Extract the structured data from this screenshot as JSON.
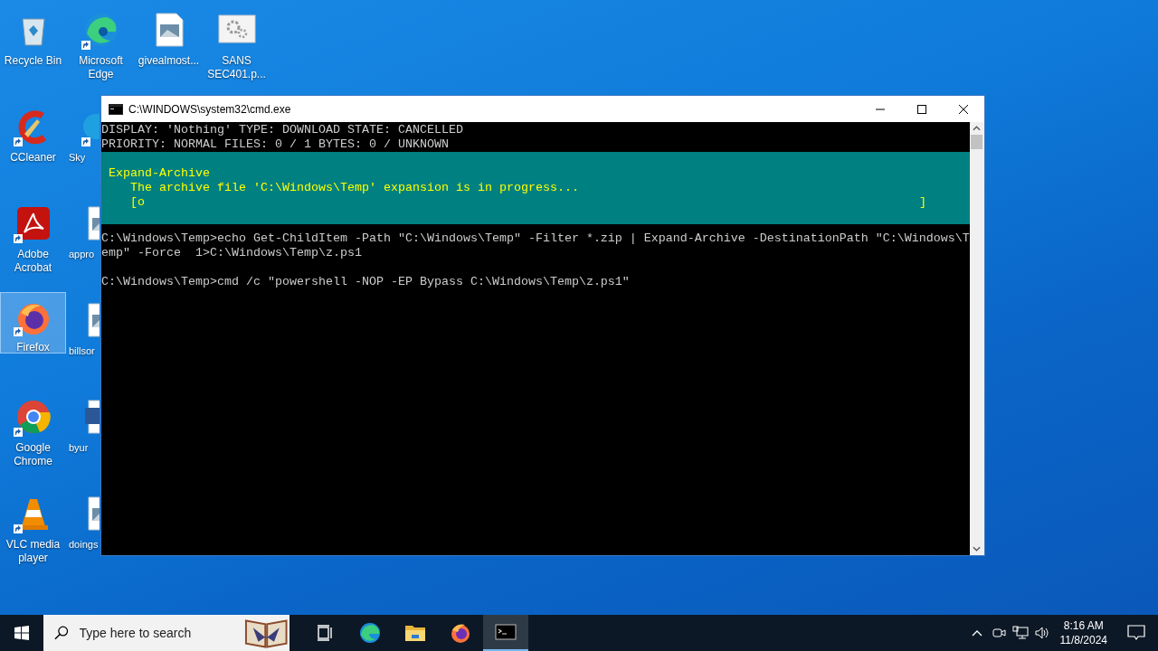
{
  "desktop_columns": [
    [
      {
        "kind": "recycle-bin",
        "label": "Recycle Bin",
        "shortcut": false,
        "selected": false
      },
      {
        "kind": "ccleaner",
        "label": "CCleaner",
        "shortcut": true,
        "selected": false
      },
      {
        "kind": "acrobat",
        "label": "Adobe Acrobat",
        "shortcut": true,
        "selected": false
      },
      {
        "kind": "firefox",
        "label": "Firefox",
        "shortcut": true,
        "selected": true
      },
      {
        "kind": "chrome",
        "label": "Google Chrome",
        "shortcut": true,
        "selected": false
      },
      {
        "kind": "vlc",
        "label": "VLC media player",
        "shortcut": true,
        "selected": false
      }
    ],
    [
      {
        "kind": "edge",
        "label": "Microsoft Edge",
        "shortcut": true,
        "selected": false
      },
      {
        "kind": "skype",
        "label": "Sky",
        "shortcut": true,
        "selected": false
      },
      {
        "kind": "image-file",
        "label": "appro",
        "shortcut": false,
        "selected": false
      },
      {
        "kind": "image-file",
        "label": "billsor",
        "shortcut": false,
        "selected": false
      },
      {
        "kind": "word",
        "label": "byur",
        "shortcut": false,
        "selected": false
      },
      {
        "kind": "image-file",
        "label": "doings",
        "shortcut": false,
        "selected": false
      }
    ],
    [
      {
        "kind": "image-file",
        "label": "givealmost...",
        "shortcut": false,
        "selected": false
      }
    ],
    [
      {
        "kind": "settings-file",
        "label": "SANS SEC401.p...",
        "shortcut": false,
        "selected": false
      }
    ]
  ],
  "window": {
    "title": "C:\\WINDOWS\\system32\\cmd.exe",
    "console": [
      {
        "kind": "text",
        "text": "DISPLAY: 'Nothing' TYPE: DOWNLOAD STATE: CANCELLED"
      },
      {
        "kind": "text",
        "text": "PRIORITY: NORMAL FILES: 0 / 1 BYTES: 0 / UNKNOWN"
      },
      {
        "kind": "progress",
        "title": "Expand-Archive",
        "message": "The archive file 'C:\\Windows\\Temp' expansion is in progress...",
        "bar_start": "[o",
        "bar_end": "]"
      },
      {
        "kind": "text",
        "text": "C:\\Windows\\Temp>echo Get-ChildItem -Path \"C:\\Windows\\Temp\" -Filter *.zip | Expand-Archive -DestinationPath \"C:\\Windows\\T"
      },
      {
        "kind": "text",
        "text": "emp\" -Force  1>C:\\Windows\\Temp\\z.ps1"
      },
      {
        "kind": "blank"
      },
      {
        "kind": "text",
        "text": "C:\\Windows\\Temp>cmd /c \"powershell -NOP -EP Bypass C:\\Windows\\Temp\\z.ps1\""
      }
    ]
  },
  "taskbar": {
    "search": {
      "placeholder": "Type here to search"
    },
    "apps": [
      {
        "kind": "task-view",
        "selected": false
      },
      {
        "kind": "edge",
        "selected": false
      },
      {
        "kind": "explorer",
        "selected": false
      },
      {
        "kind": "firefox",
        "selected": false
      },
      {
        "kind": "cmd",
        "selected": true
      }
    ],
    "time": "8:16 AM",
    "date": "11/8/2024"
  }
}
